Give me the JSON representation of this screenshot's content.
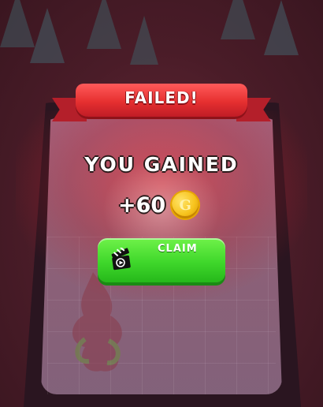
{
  "result_banner": {
    "title": "FAILED!"
  },
  "summary": {
    "headline": "YOU GAINED",
    "amount": "+60"
  },
  "coin_icon": {
    "icon": "gold-coin-icon",
    "glyph": "G"
  },
  "claim": {
    "label": "CLAIM",
    "icon": "clapperboard-video-icon"
  },
  "colors": {
    "banner_red": "#e63030",
    "button_green": "#3fd72b",
    "coin_gold": "#f7c31d",
    "backdrop": "#4a1f2a"
  }
}
